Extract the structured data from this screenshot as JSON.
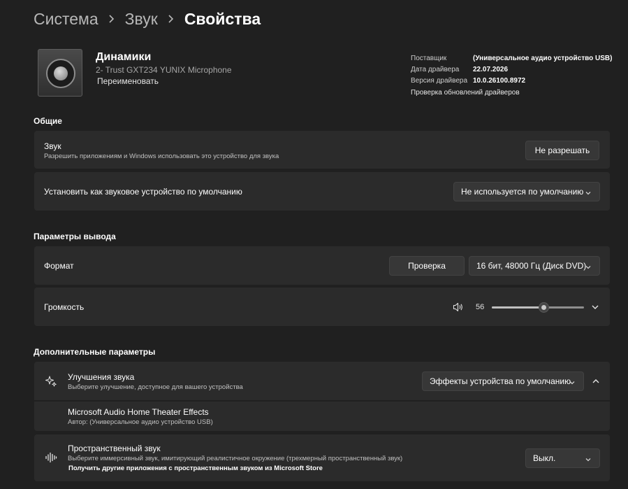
{
  "breadcrumb": {
    "items": [
      "Система",
      "Звук"
    ],
    "current": "Свойства"
  },
  "device": {
    "name": "Динамики",
    "model": "2- Trust GXT234 YUNIX Microphone",
    "rename_label": "Переименовать",
    "icon": "speaker-icon"
  },
  "driver": {
    "provider_key": "Поставщик",
    "provider_val": "(Универсальное аудио устройство USB)",
    "date_key": "Дата драйвера",
    "date_val": "22.07.2026",
    "version_key": "Версия драйвера",
    "version_val": "10.0.26100.8972",
    "update_link": "Проверка обновлений драйверов"
  },
  "general": {
    "title": "Общие",
    "audio": {
      "title": "Звук",
      "subtitle": "Разрешить приложениям и Windows использовать это устройство для звука",
      "button": "Не разрешать"
    },
    "default_device": {
      "title": "Установить как звуковое устройство по умолчанию",
      "selected": "Не используется по умолчанию"
    }
  },
  "output": {
    "title": "Параметры вывода",
    "format": {
      "title": "Формат",
      "test_button": "Проверка",
      "selected": "16 бит, 48000 Гц (Диск DVD)"
    },
    "volume": {
      "title": "Громкость",
      "value": "56",
      "level": 0.56
    }
  },
  "advanced": {
    "title": "Дополнительные параметры",
    "enhancements": {
      "title": "Улучшения звука",
      "subtitle": "Выберите улучшение, доступное для вашего устройства",
      "selected": "Эффекты устройства по умолчанию",
      "effect_name": "Microsoft Audio Home Theater Effects",
      "effect_author": "Автор: (Универсальное аудио устройство USB)"
    },
    "spatial": {
      "title": "Пространственный звук",
      "subtitle": "Выберите иммерсивный звук, имитирующий реалистичное окружение (трехмерный пространственный звук)",
      "store_link": "Получить другие приложения с пространственным звуком из Microsoft Store",
      "selected": "Выкл."
    }
  },
  "colors": {
    "background": "#202020",
    "card": "#2b2b2b",
    "control": "#373737",
    "text": "#ffffff",
    "muted": "#c0c0c0"
  }
}
